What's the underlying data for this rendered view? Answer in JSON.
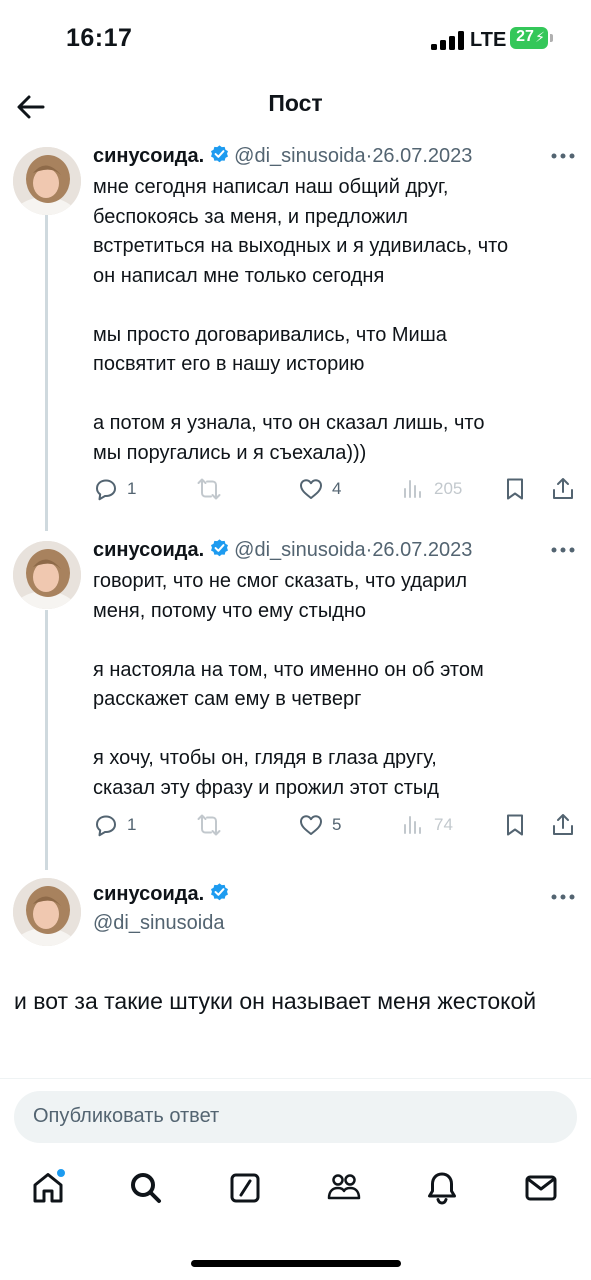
{
  "status_bar": {
    "time": "16:17",
    "network": "LTE",
    "battery": "27"
  },
  "header": {
    "title": "Пост"
  },
  "tweets": [
    {
      "name": "синусоида.",
      "handle": "@di_sinusoida",
      "separator": "·",
      "date": "26.07.2023",
      "text": "мне сегодня написал наш общий друг,\nбеспокоясь за меня, и предложил\nвстретиться на выходных и я удивилась, что\nон написал мне только сегодня\n\nмы просто договаривались, что Миша\nпосвятит его в нашу историю\n\nа потом я узнала, что он сказал лишь, что\nмы поругались и я съехала)))",
      "replies": "1",
      "likes": "4",
      "views": "205"
    },
    {
      "name": "синусоида.",
      "handle": "@di_sinusoida",
      "separator": "·",
      "date": "26.07.2023",
      "text": "говорит, что не смог сказать, что ударил\nменя, потому что ему стыдно\n\nя настояла на том, что именно он об этом\nрасскажет сам ему в четверг\n\nя хочу, чтобы он, глядя в глаза другу,\nсказал эту фразу и прожил этот стыд",
      "replies": "1",
      "likes": "5",
      "views": "74"
    }
  ],
  "main_tweet": {
    "name": "синусоида.",
    "handle": "@di_sinusoida",
    "text": "и вот за такие штуки он называет меня жестокой"
  },
  "reply_box": {
    "placeholder": "Опубликовать ответ"
  },
  "bottom_nav": [
    "home-icon",
    "search-icon",
    "grok-icon",
    "communities-icon",
    "notifications-icon",
    "messages-icon"
  ],
  "colors": {
    "verified": "#1d9bf0",
    "secondary_text": "#536471",
    "battery": "#34c759",
    "thread_line": "#cfd9de"
  }
}
